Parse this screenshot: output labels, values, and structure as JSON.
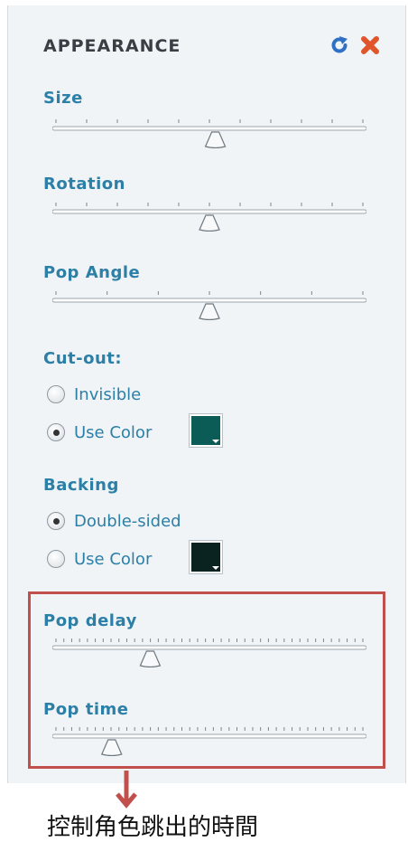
{
  "panel": {
    "title": "APPEARANCE",
    "icons": {
      "refresh": "refresh-icon",
      "close": "close-icon"
    },
    "colors": {
      "accent": "#2c7fa6",
      "highlight": "#c1504d"
    }
  },
  "sliders": {
    "size": {
      "label": "Size",
      "value": 0.52
    },
    "rotation": {
      "label": "Rotation",
      "value": 0.5
    },
    "pop_angle": {
      "label": "Pop Angle",
      "value": 0.5
    },
    "pop_delay": {
      "label": "Pop delay",
      "value": 0.3
    },
    "pop_time": {
      "label": "Pop time",
      "value": 0.17
    }
  },
  "cutout": {
    "label": "Cut-out:",
    "options": [
      {
        "label": "Invisible",
        "selected": false
      },
      {
        "label": "Use Color",
        "selected": true,
        "color": "#0b5b56"
      }
    ]
  },
  "backing": {
    "label": "Backing",
    "options": [
      {
        "label": "Double-sided",
        "selected": true
      },
      {
        "label": "Use Color",
        "selected": false,
        "color": "#0a2220"
      }
    ]
  },
  "annotation": {
    "caption": "控制角色跳出的時間"
  }
}
